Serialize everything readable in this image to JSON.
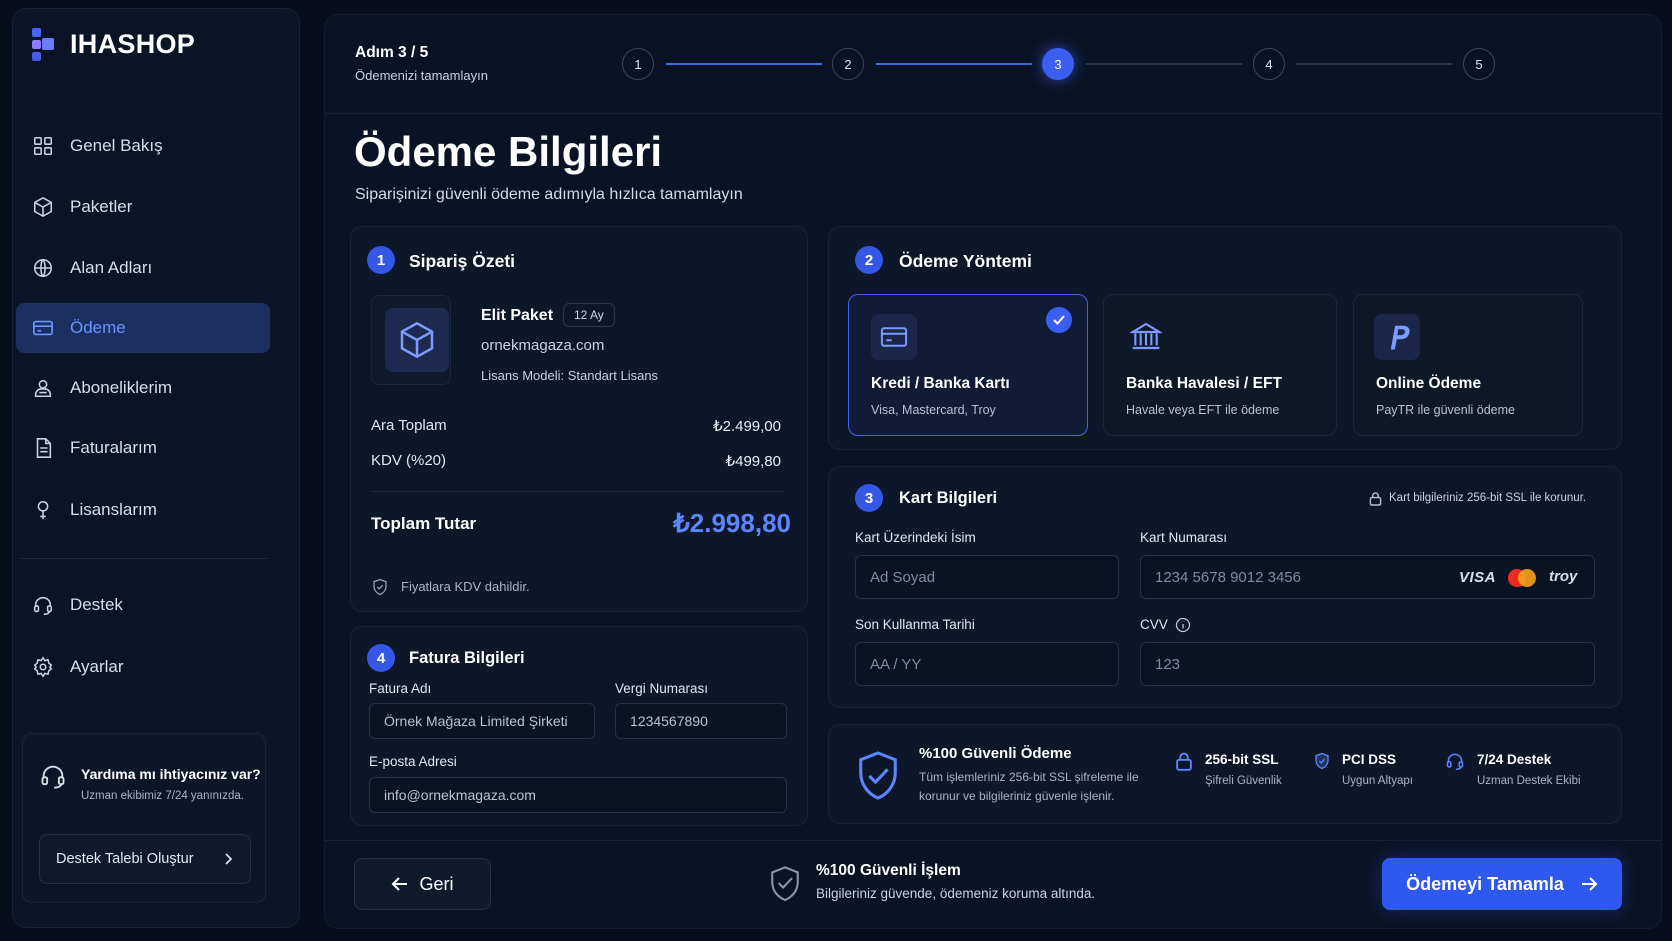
{
  "brand": {
    "name": "IHASHOP"
  },
  "sidebar": {
    "items": [
      {
        "label": "Genel Bakış",
        "icon": "grid-icon"
      },
      {
        "label": "Paketler",
        "icon": "box-icon"
      },
      {
        "label": "Alan Adları",
        "icon": "globe-icon"
      },
      {
        "label": "Ödeme",
        "icon": "credit-card-icon",
        "active": true
      },
      {
        "label": "Aboneliklerim",
        "icon": "subscription-icon"
      },
      {
        "label": "Faturalarım",
        "icon": "invoice-icon"
      },
      {
        "label": "Lisanslarım",
        "icon": "license-icon"
      },
      {
        "label": "Destek",
        "icon": "headset-icon"
      },
      {
        "label": "Ayarlar",
        "icon": "gear-icon"
      }
    ],
    "help": {
      "title": "Yardıma mı ihtiyacınız var?",
      "subtitle": "Uzman ekibimiz 7/24 yanınızda.",
      "button": "Destek Talebi Oluştur"
    }
  },
  "stepper": {
    "label": "Adım 3 / 5",
    "sub": "Ödemenizi tamamlayın",
    "steps": [
      "1",
      "2",
      "3",
      "4",
      "5"
    ],
    "current": 3
  },
  "page": {
    "title": "Ödeme Bilgileri",
    "subtitle": "Siparişinizi güvenli ödeme adımıyla hızlıca tamamlayın"
  },
  "order": {
    "badge": "1",
    "title": "Sipariş Özeti",
    "product_name": "Elit Paket",
    "duration": "12 Ay",
    "domain": "ornekmagaza.com",
    "license": "Lisans Modeli: Standart Lisans",
    "subtotal_label": "Ara Toplam",
    "subtotal": "₺2.499,00",
    "tax_label": "KDV (%20)",
    "tax": "₺499,80",
    "total_label": "Toplam Tutar",
    "total": "₺2.998,80",
    "note": "Fiyatlara KDV dahildir."
  },
  "invoice": {
    "badge": "4",
    "title": "Fatura Bilgileri",
    "name_label": "Fatura Adı",
    "name_value": "Örnek Mağaza Limited Şirketi",
    "tax_label": "Vergi Numarası",
    "tax_value": "1234567890",
    "email_label": "E-posta Adresi",
    "email_value": "info@ornekmagaza.com"
  },
  "payment_method": {
    "badge": "2",
    "title": "Ödeme Yöntemi",
    "options": [
      {
        "title": "Kredi / Banka Kartı",
        "sub": "Visa, Mastercard, Troy",
        "icon": "credit-card-icon",
        "selected": true
      },
      {
        "title": "Banka Havalesi / EFT",
        "sub": "Havale veya EFT ile ödeme",
        "icon": "bank-icon"
      },
      {
        "title": "Online Ödeme",
        "sub": "PayTR ile güvenli ödeme",
        "icon": "paytr-logo-icon"
      }
    ]
  },
  "card": {
    "badge": "3",
    "title": "Kart Bilgileri",
    "ssl_note": "Kart bilgileriniz 256-bit SSL ile korunur.",
    "name_label": "Kart Üzerindeki İsim",
    "name_placeholder": "Ad Soyad",
    "number_label": "Kart Numarası",
    "number_placeholder": "1234 5678 9012 3456",
    "expiry_label": "Son Kullanma Tarihi",
    "expiry_placeholder": "AA / YY",
    "cvv_label": "CVV",
    "cvv_placeholder": "123",
    "brands": {
      "visa": "VISA",
      "troy": "troy"
    }
  },
  "security": {
    "title": "%100 Güvenli Ödeme",
    "line1": "Tüm işlemleriniz 256-bit SSL şifreleme ile",
    "line2": "korunur ve bilgileriniz güvenle işlenir.",
    "features": [
      {
        "title": "256-bit SSL",
        "sub": "Şifreli Güvenlik",
        "icon": "lock-icon"
      },
      {
        "title": "PCI DSS",
        "sub": "Uygun Altyapı",
        "icon": "shield-check-icon"
      },
      {
        "title": "7/24 Destek",
        "sub": "Uzman Destek Ekibi",
        "icon": "headset-icon"
      }
    ]
  },
  "footer": {
    "back": "Geri",
    "secure_title": "%100 Güvenli İşlem",
    "secure_sub": "Bilgileriniz güvende, ödemeniz koruma altında.",
    "pay": "Ödemeyi Tamamla"
  },
  "colors": {
    "accent": "#3b5ef0",
    "background": "#070d1c",
    "card": "#0d1729",
    "price": "#5b86ff"
  }
}
